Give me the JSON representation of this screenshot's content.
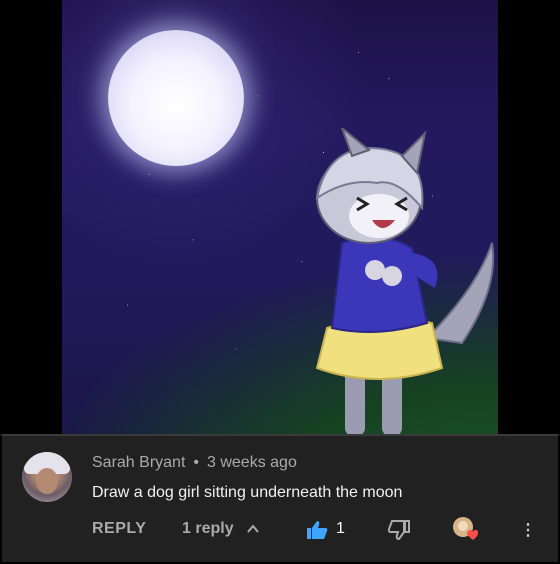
{
  "comment": {
    "author": "Sarah Bryant",
    "separator": "•",
    "timestamp": "3 weeks ago",
    "text": "Draw a dog girl sitting underneath the moon"
  },
  "actions": {
    "reply_label": "REPLY",
    "replies_label": "1 reply",
    "like_count": "1",
    "more_label": "⋮"
  },
  "icons": {
    "expand": "chevron-up-icon",
    "like": "thumbs-up-icon",
    "dislike": "thumbs-down-icon",
    "heart": "creator-heart-icon",
    "more": "more-vert-icon"
  },
  "colors": {
    "like_active": "#3ea6ff",
    "heart": "#ff4e45",
    "comment_bg": "#212121"
  }
}
